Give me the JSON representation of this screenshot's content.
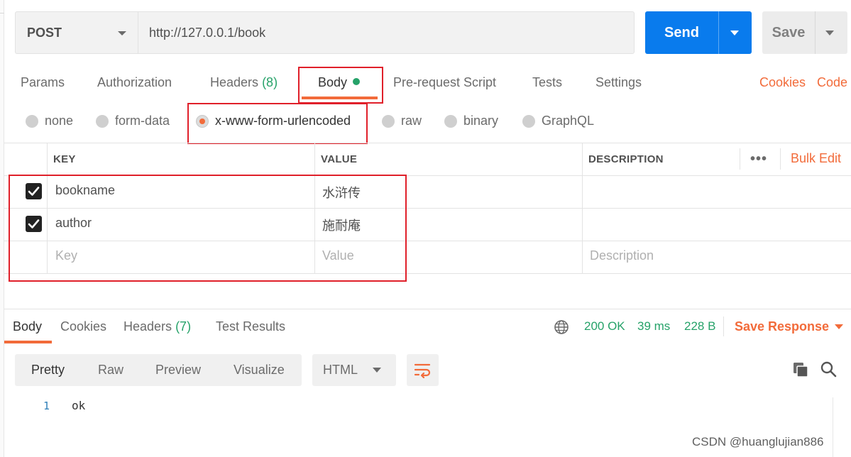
{
  "request": {
    "method": "POST",
    "url": "http://127.0.0.1/book",
    "send_label": "Send",
    "save_label": "Save"
  },
  "request_tabs": {
    "params": "Params",
    "authorization": "Authorization",
    "headers": "Headers",
    "headers_count": "(8)",
    "body": "Body",
    "prerequest": "Pre-request Script",
    "tests": "Tests",
    "settings": "Settings",
    "cookies": "Cookies",
    "code": "Code"
  },
  "body_modes": {
    "none": "none",
    "form_data": "form-data",
    "urlencoded": "x-www-form-urlencoded",
    "raw": "raw",
    "binary": "binary",
    "graphql": "GraphQL",
    "selected": "x-www-form-urlencoded"
  },
  "params_table": {
    "headers": [
      "KEY",
      "VALUE",
      "DESCRIPTION"
    ],
    "more": "•••",
    "bulk_edit": "Bulk Edit",
    "rows": [
      {
        "checked": true,
        "key": "bookname",
        "value": "水浒传",
        "description": ""
      },
      {
        "checked": true,
        "key": "author",
        "value": "施耐庵",
        "description": ""
      }
    ],
    "placeholder": {
      "key": "Key",
      "value": "Value",
      "description": "Description"
    }
  },
  "response_tabs": {
    "body": "Body",
    "cookies": "Cookies",
    "headers": "Headers",
    "headers_count": "(7)",
    "test_results": "Test Results"
  },
  "response_status": {
    "status": "200 OK",
    "time": "39 ms",
    "size": "228 B",
    "save_response": "Save Response"
  },
  "viewer": {
    "modes": [
      "Pretty",
      "Raw",
      "Preview",
      "Visualize"
    ],
    "format": "HTML",
    "line_number": "1",
    "content": "ok"
  },
  "watermark": "CSDN @huanglujian886",
  "colors": {
    "accent": "#f26b3a",
    "send_blue": "#097bed",
    "success_green": "#26a269",
    "highlight_red": "#e0202a"
  }
}
